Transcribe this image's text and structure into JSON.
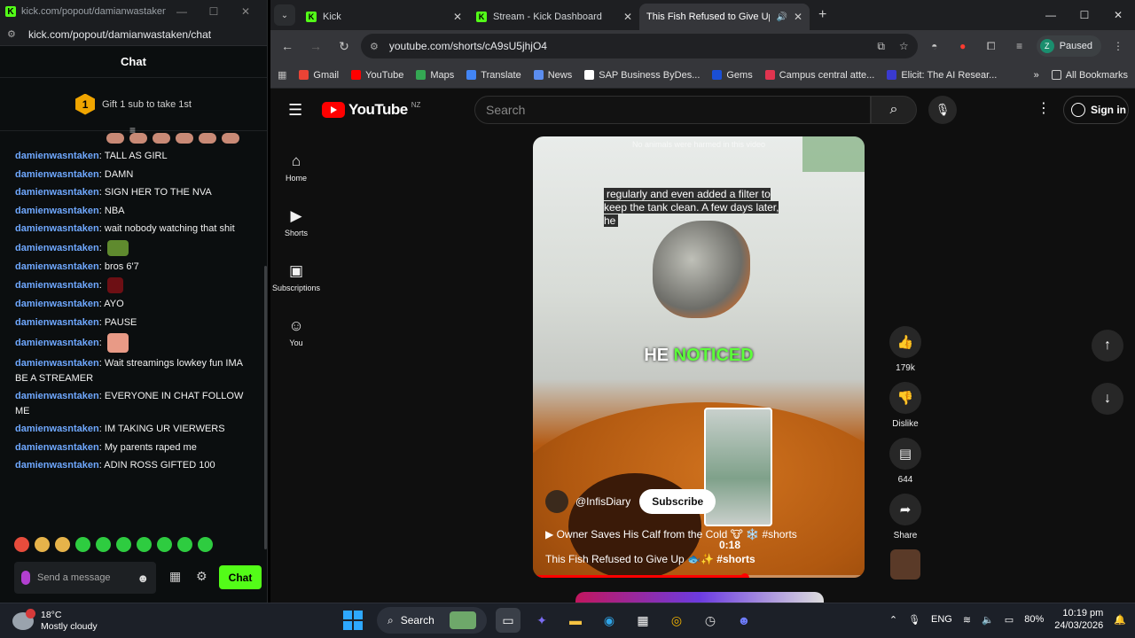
{
  "kick_window": {
    "title": "kick.com/popout/damianwastaken...",
    "url": "kick.com/popout/damianwastaken/chat",
    "header": "Chat",
    "gift_badge": "1",
    "gift_text": "Gift 1 sub to take 1st",
    "messages": [
      {
        "user": "damienwasntaken",
        "text": "TALL AS GIRL"
      },
      {
        "user": "damienwasntaken",
        "text": "DAMN"
      },
      {
        "user": "damienwasntaken",
        "text": "SIGN HER TO THE NVA"
      },
      {
        "user": "damienwasntaken",
        "text": "NBA"
      },
      {
        "user": "damienwasntaken",
        "text": "wait nobody watching that shit"
      },
      {
        "user": "damienwasntaken",
        "text": ""
      },
      {
        "user": "damienwasntaken",
        "text": "bros 6'7"
      },
      {
        "user": "damienwasntaken",
        "text": ""
      },
      {
        "user": "damienwasntaken",
        "text": "AYO"
      },
      {
        "user": "damienwasntaken",
        "text": "PAUSE"
      },
      {
        "user": "damienwasntaken",
        "text": ""
      },
      {
        "user": "damienwasntaken",
        "text": "Wait streamings lowkey fun IMA BE A STREAMER"
      },
      {
        "user": "damienwasntaken",
        "text": "EVERYONE IN CHAT FOLLOW ME"
      },
      {
        "user": "damienwasntaken",
        "text": "IM TAKING UR VIERWERS"
      },
      {
        "user": "damienwasntaken",
        "text": "My parents raped me"
      },
      {
        "user": "damienwasntaken",
        "text": "ADIN ROSS GIFTED 100"
      }
    ],
    "composer_placeholder": "Send a message",
    "chat_button": "Chat"
  },
  "browser": {
    "tabs": [
      {
        "title": "Kick",
        "favicon": "kick"
      },
      {
        "title": "Stream - Kick Dashboard",
        "favicon": "kick"
      },
      {
        "title": "This Fish Refused to Give Up",
        "favicon": "youtube",
        "active": true
      }
    ],
    "url": "youtube.com/shorts/cA9sU5jhjO4",
    "profile_initial": "Z",
    "profile_status": "Paused",
    "bookmarks": [
      {
        "label": "Gmail",
        "color": "#ea4335"
      },
      {
        "label": "YouTube",
        "color": "#ff0000"
      },
      {
        "label": "Maps",
        "color": "#34a853"
      },
      {
        "label": "Translate",
        "color": "#4285f4"
      },
      {
        "label": "News",
        "color": "#5b8def"
      },
      {
        "label": "SAP Business ByDes...",
        "color": "#ffffff"
      },
      {
        "label": "Gems",
        "color": "#1a4fd6"
      },
      {
        "label": "Campus central atte...",
        "color": "#e0344f"
      },
      {
        "label": "Elicit: The AI Resear...",
        "color": "#3a3ad0"
      }
    ],
    "all_bookmarks": "All Bookmarks"
  },
  "youtube": {
    "logo_text": "YouTube",
    "region": "NZ",
    "search_placeholder": "Search",
    "sign_in": "Sign in",
    "sidebar": [
      {
        "label": "Home",
        "icon": "home-icon"
      },
      {
        "label": "Shorts",
        "icon": "shorts-icon"
      },
      {
        "label": "Subscriptions",
        "icon": "subscriptions-icon"
      },
      {
        "label": "You",
        "icon": "you-icon"
      }
    ],
    "short": {
      "watermark": "No animals were harmed in this video",
      "caption": "regularly and even added a filter to keep the tank clean. A few days later, he",
      "overlay_white": "HE",
      "overlay_green": "NOTICED",
      "preview_time": "0:18",
      "channel": "@InfisDiary",
      "subscribe": "Subscribe",
      "related": "Owner Saves His Calf from the Cold 🐮 ❄️ #shorts",
      "title": "This Fish Refused to Give Up 🐟✨",
      "title_tag": "#shorts",
      "progress": 0.64
    },
    "actions": {
      "likes": "179k",
      "dislike": "Dislike",
      "comments": "644",
      "share": "Share"
    }
  },
  "taskbar": {
    "temp": "18°C",
    "weather": "Mostly cloudy",
    "search": "Search",
    "lang": "ENG",
    "battery": "80%",
    "time": "10:19 pm",
    "date": "24/03/2026"
  }
}
